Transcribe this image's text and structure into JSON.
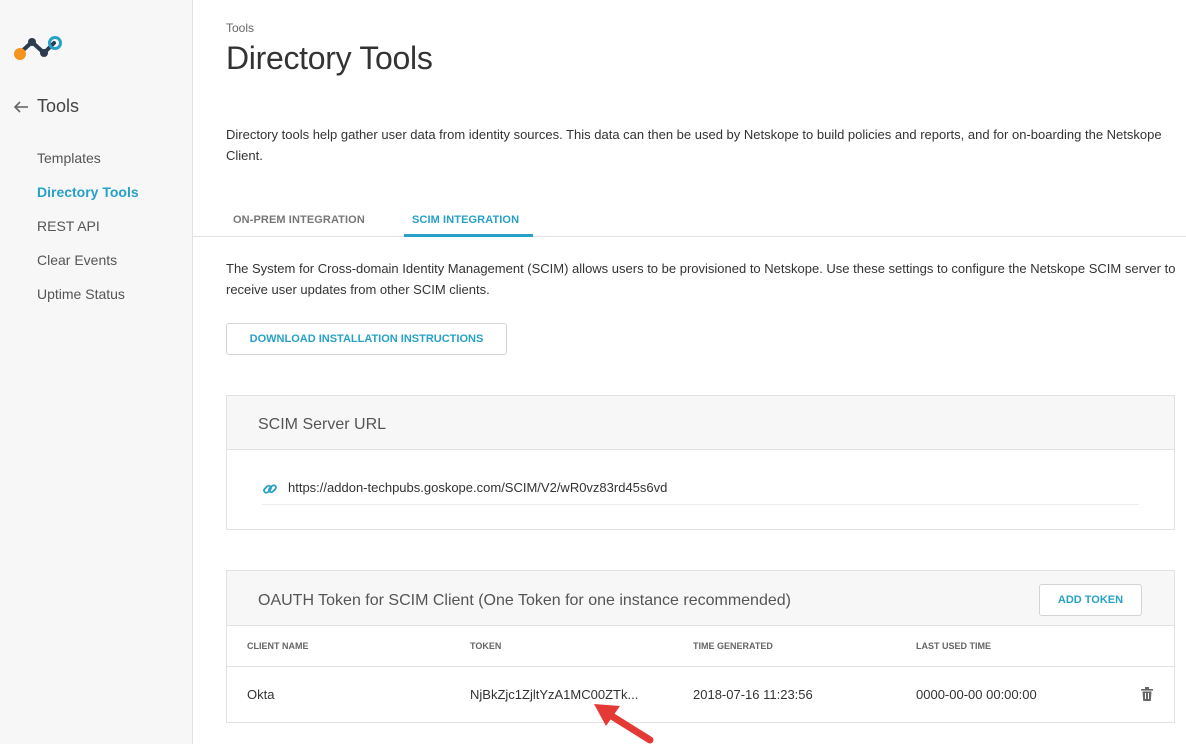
{
  "sidebar": {
    "back_label": "Tools",
    "items": [
      {
        "label": "Templates"
      },
      {
        "label": "Directory Tools"
      },
      {
        "label": "REST API"
      },
      {
        "label": "Clear Events"
      },
      {
        "label": "Uptime Status"
      }
    ]
  },
  "header": {
    "breadcrumb": "Tools",
    "title": "Directory Tools",
    "description": "Directory tools help gather user data from identity sources. This data can then be used by Netskope to build policies and reports, and for on-boarding the Netskope Client."
  },
  "tabs": [
    {
      "label": "ON-PREM INTEGRATION"
    },
    {
      "label": "SCIM INTEGRATION"
    }
  ],
  "scim": {
    "description": "The System for Cross-domain Identity Management (SCIM) allows users to be provisioned to Netskope. Use these settings to configure the Netskope SCIM server to receive user updates from other SCIM clients.",
    "download_button": "DOWNLOAD INSTALLATION INSTRUCTIONS",
    "server_url_title": "SCIM Server URL",
    "server_url": "https://addon-techpubs.goskope.com/SCIM/V2/wR0vz83rd45s6vd",
    "token_title": "OAUTH Token for SCIM Client (One Token for one instance recommended)",
    "add_token_button": "ADD TOKEN",
    "columns": [
      "CLIENT NAME",
      "TOKEN",
      "TIME GENERATED",
      "LAST USED TIME"
    ],
    "rows": [
      {
        "client_name": "Okta",
        "token": "NjBkZjc1ZjltYzA1MC00ZTk...",
        "time_generated": "2018-07-16 11:23:56",
        "last_used": "0000-00-00 00:00:00"
      }
    ]
  },
  "colors": {
    "accent": "#27a1c7",
    "logo_orange": "#f7941d",
    "logo_dark": "#2d3b4e",
    "logo_blue": "#27a1c7",
    "annotation_arrow": "#e53935"
  },
  "icons": [
    "netskope-logo",
    "back-arrow-icon",
    "link-icon",
    "trash-icon",
    "red-annotation-arrow"
  ]
}
